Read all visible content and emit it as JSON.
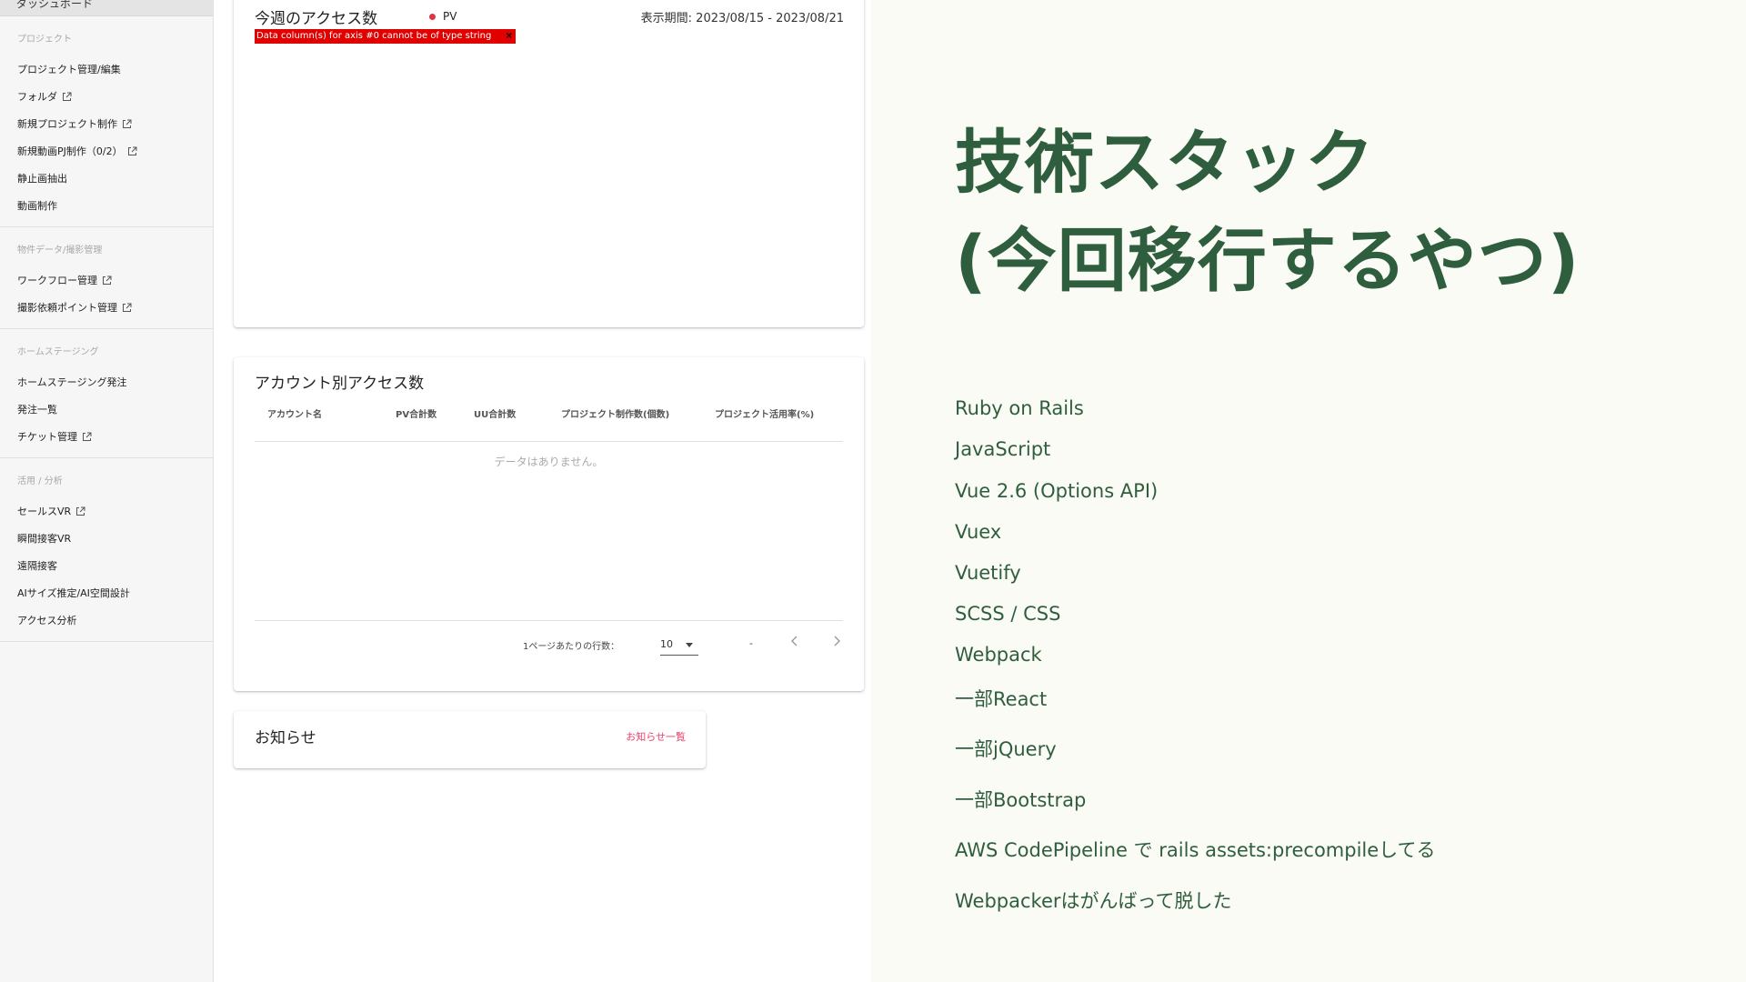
{
  "sidebar": {
    "top_item": "ダッシュボード",
    "sections": [
      {
        "header": "プロジェクト",
        "items": [
          {
            "label": "プロジェクト管理/編集",
            "external": false
          },
          {
            "label": "フォルダ",
            "external": true
          },
          {
            "label": "新規プロジェクト制作",
            "external": true
          },
          {
            "label": "新規動画PJ制作（0/2）",
            "external": true
          },
          {
            "label": "静止画抽出",
            "external": false
          },
          {
            "label": "動画制作",
            "external": false
          }
        ]
      },
      {
        "header": "物件データ/撮影管理",
        "items": [
          {
            "label": "ワークフロー管理",
            "external": true
          },
          {
            "label": "撮影依頼ポイント管理",
            "external": true
          }
        ]
      },
      {
        "header": "ホームステージング",
        "items": [
          {
            "label": "ホームステージング発注",
            "external": false
          },
          {
            "label": "発注一覧",
            "external": false
          },
          {
            "label": "チケット管理",
            "external": true
          }
        ]
      },
      {
        "header": "活用 / 分析",
        "items": [
          {
            "label": "セールスVR",
            "external": true
          },
          {
            "label": "瞬間接客VR",
            "external": false
          },
          {
            "label": "遠隔接客",
            "external": false
          },
          {
            "label": "AIサイズ推定/AI空間設計",
            "external": false
          },
          {
            "label": "アクセス分析",
            "external": false
          }
        ]
      }
    ]
  },
  "weekly_access": {
    "title": "今週のアクセス数",
    "legend": "PV",
    "legend_color": "#dc3545",
    "period": "表示期間: 2023/08/15 - 2023/08/21",
    "error": "Data column(s) for axis #0 cannot be of type string",
    "error_close": "×"
  },
  "account_access": {
    "title": "アカウント別アクセス数",
    "columns": [
      "アカウント名",
      "PV合計数",
      "UU合計数",
      "プロジェクト制作数(個数)",
      "プロジェクト活用率(%)"
    ],
    "empty_text": "データはありません。",
    "rows_per_page_label": "1ページあたりの行数：",
    "rows_per_page": "10",
    "range": "-"
  },
  "news": {
    "title": "お知らせ",
    "link": "お知らせ一覧",
    "link_color": "#e7406b"
  },
  "slide": {
    "title_line1": "技術スタック",
    "title_line2": "(今回移行するやつ)",
    "title_color": "#2f5e3e",
    "items": [
      "Ruby on Rails",
      "JavaScript",
      "Vue 2.6 (Options API)",
      "Vuex",
      "Vuetify",
      "SCSS / CSS",
      "Webpack",
      "一部React",
      "一部jQuery",
      "一部Bootstrap",
      "AWS CodePipeline で rails assets:precompileしてる",
      "Webpackerはがんばって脱した"
    ]
  }
}
